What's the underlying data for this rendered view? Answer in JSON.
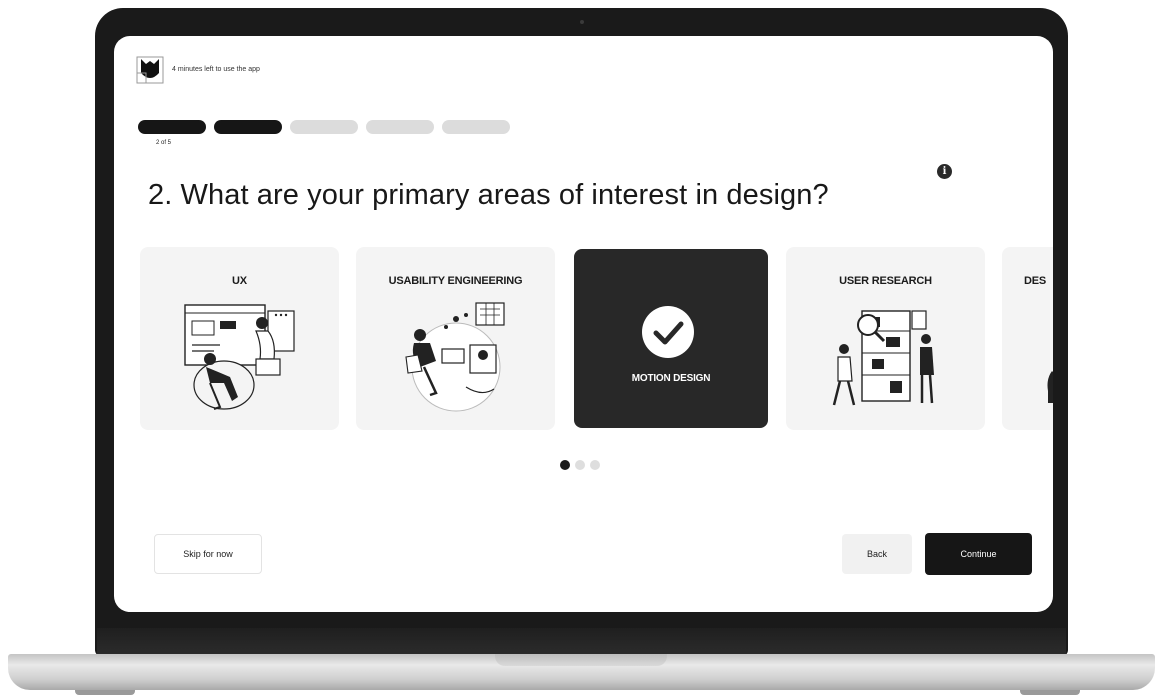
{
  "app": {
    "timer_text": "4 minutes left to use the app"
  },
  "progress": {
    "total_steps": 5,
    "completed_steps": 2,
    "step_label": "2 of 5"
  },
  "question": {
    "text": "2. What are your primary areas of interest in design?",
    "info_icon": "i"
  },
  "cards": [
    {
      "label": "UX",
      "selected": false,
      "icon": "ux-illustration"
    },
    {
      "label": "USABILITY ENGINEERING",
      "selected": false,
      "icon": "usability-illustration"
    },
    {
      "label": "MOTION DESIGN",
      "selected": true,
      "icon": "check-icon"
    },
    {
      "label": "USER RESEARCH",
      "selected": false,
      "icon": "user-research-illustration"
    },
    {
      "label": "DES",
      "selected": false,
      "icon": "design-illustration"
    }
  ],
  "pagination": {
    "pages": 3,
    "active_index": 0
  },
  "buttons": {
    "skip_label": "Skip for now",
    "back_label": "Back",
    "continue_label": "Continue"
  },
  "colors": {
    "accent": "#161616",
    "card_bg": "#f4f4f4",
    "selected_card_bg": "#282828",
    "inactive_segment": "#dcdcdc"
  }
}
